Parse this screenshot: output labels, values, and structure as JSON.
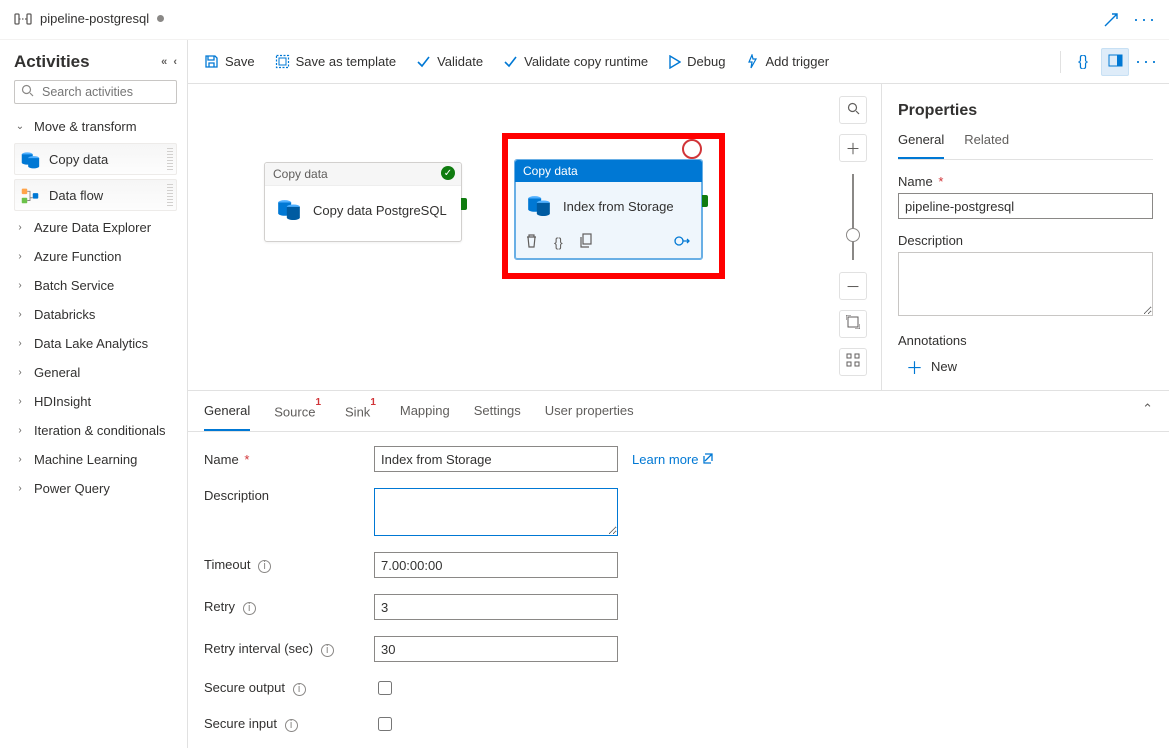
{
  "tab": {
    "title": "pipeline-postgresql"
  },
  "toolbar": {
    "save": "Save",
    "save_tpl": "Save as template",
    "validate": "Validate",
    "validate_copy": "Validate copy runtime",
    "debug": "Debug",
    "add_trigger": "Add trigger"
  },
  "activities_panel": {
    "title": "Activities",
    "search_placeholder": "Search activities",
    "open_group": "Move & transform",
    "items": [
      {
        "label": "Copy data"
      },
      {
        "label": "Data flow"
      }
    ],
    "groups": [
      "Azure Data Explorer",
      "Azure Function",
      "Batch Service",
      "Databricks",
      "Data Lake Analytics",
      "General",
      "HDInsight",
      "Iteration & conditionals",
      "Machine Learning",
      "Power Query"
    ]
  },
  "canvas": {
    "node1": {
      "type": "Copy data",
      "title": "Copy data PostgreSQL"
    },
    "node2": {
      "type": "Copy data",
      "title": "Index from Storage"
    }
  },
  "node_tabs": [
    "General",
    "Source",
    "Sink",
    "Mapping",
    "Settings",
    "User properties"
  ],
  "node_tabs_err": {
    "Source": true,
    "Sink": true
  },
  "general": {
    "name_label": "Name",
    "name_value": "Index from Storage",
    "learn_more": "Learn more",
    "desc_label": "Description",
    "desc_value": "",
    "timeout_label": "Timeout",
    "timeout_value": "7.00:00:00",
    "retry_label": "Retry",
    "retry_value": "3",
    "retry_int_label": "Retry interval (sec)",
    "retry_int_value": "30",
    "secure_out_label": "Secure output",
    "secure_in_label": "Secure input"
  },
  "properties": {
    "title": "Properties",
    "tabs": [
      "General",
      "Related"
    ],
    "name_label": "Name",
    "name_value": "pipeline-postgresql",
    "desc_label": "Description",
    "desc_value": "",
    "ann_label": "Annotations",
    "ann_new": "New"
  }
}
